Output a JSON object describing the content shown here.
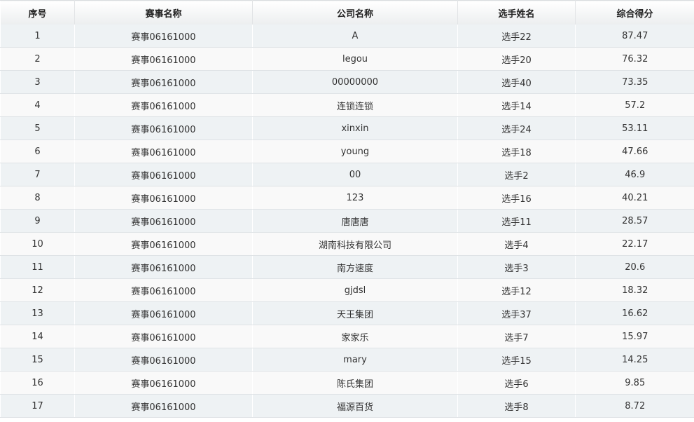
{
  "table": {
    "headers": [
      "序号",
      "赛事名称",
      "公司名称",
      "选手姓名",
      "综合得分"
    ],
    "rows": [
      [
        "1",
        "赛事06161000",
        "A",
        "选手22",
        "87.47"
      ],
      [
        "2",
        "赛事06161000",
        "legou",
        "选手20",
        "76.32"
      ],
      [
        "3",
        "赛事06161000",
        "00000000",
        "选手40",
        "73.35"
      ],
      [
        "4",
        "赛事06161000",
        "连锁连锁",
        "选手14",
        "57.2"
      ],
      [
        "5",
        "赛事06161000",
        "xinxin",
        "选手24",
        "53.11"
      ],
      [
        "6",
        "赛事06161000",
        "young",
        "选手18",
        "47.66"
      ],
      [
        "7",
        "赛事06161000",
        "00",
        "选手2",
        "46.9"
      ],
      [
        "8",
        "赛事06161000",
        "123",
        "选手16",
        "40.21"
      ],
      [
        "9",
        "赛事06161000",
        "唐唐唐",
        "选手11",
        "28.57"
      ],
      [
        "10",
        "赛事06161000",
        "湖南科技有限公司",
        "选手4",
        "22.17"
      ],
      [
        "11",
        "赛事06161000",
        "南方速度",
        "选手3",
        "20.6"
      ],
      [
        "12",
        "赛事06161000",
        "gjdsl",
        "选手12",
        "18.32"
      ],
      [
        "13",
        "赛事06161000",
        "天王集团",
        "选手37",
        "16.62"
      ],
      [
        "14",
        "赛事06161000",
        "家家乐",
        "选手7",
        "15.97"
      ],
      [
        "15",
        "赛事06161000",
        "mary",
        "选手15",
        "14.25"
      ],
      [
        "16",
        "赛事06161000",
        "陈氏集团",
        "选手6",
        "9.85"
      ],
      [
        "17",
        "赛事06161000",
        "福源百货",
        "选手8",
        "8.72"
      ]
    ]
  },
  "colors": {
    "row_odd": "#eef2f4",
    "row_even": "#f9f9f9",
    "header_bg": "#eceeef",
    "text": "#333333"
  }
}
